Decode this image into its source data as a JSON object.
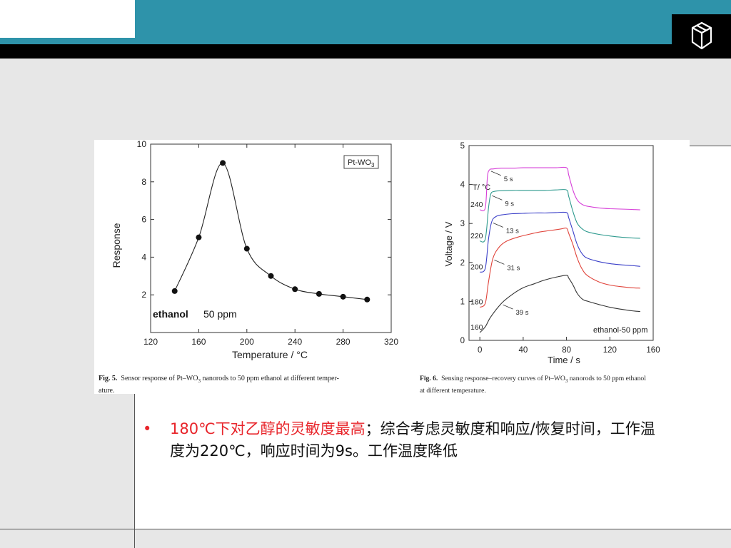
{
  "theme": {
    "teal": "#2e93aa",
    "black": "#000000",
    "red": "#e8252b"
  },
  "header": {
    "logo_icon": "cube-icon"
  },
  "figure5": {
    "caption_label": "Fig. 5.",
    "caption_text": "Sensor response of Pt–WO",
    "caption_sub": "3",
    "caption_rest": " nanorods to 50 ppm ethanol at different temper-",
    "caption_line2": "ature.",
    "legend_main": "Pt-WO",
    "legend_sub": "3",
    "annotation_gas": "ethanol",
    "annotation_conc": "50 ppm"
  },
  "figure6": {
    "caption_label": "Fig. 6.",
    "caption_text": "Sensing response–recovery curves of Pt–WO",
    "caption_sub": "3",
    "caption_rest": " nanorods to 50 ppm ethanol",
    "caption_line2": "at different temperature.",
    "temp_header": "T/ °C",
    "annotation": "ethanol-50 ppm"
  },
  "chart_data": [
    {
      "type": "line",
      "title": "",
      "xlabel": "Temperature / °C",
      "ylabel": "Response",
      "xlim": [
        120,
        320
      ],
      "ylim": [
        0,
        10
      ],
      "xticks": [
        "120",
        "160",
        "200",
        "240",
        "280",
        "320"
      ],
      "yticks": [
        "2",
        "4",
        "6",
        "8",
        "10"
      ],
      "series": [
        {
          "name": "Pt-WO3",
          "x": [
            140,
            160,
            180,
            200,
            220,
            240,
            260,
            280,
            300
          ],
          "values": [
            2.2,
            5.05,
            9.0,
            4.45,
            3.0,
            2.3,
            2.05,
            1.9,
            1.75
          ]
        }
      ]
    },
    {
      "type": "line",
      "title": "",
      "xlabel": "Time / s",
      "ylabel": "Voltage / V",
      "xlim": [
        -10,
        160
      ],
      "ylim": [
        0,
        5
      ],
      "xticks": [
        "0",
        "40",
        "80",
        "120",
        "160"
      ],
      "yticks": [
        "0",
        "1",
        "2",
        "3",
        "4",
        "5"
      ],
      "series": [
        {
          "name": "160",
          "color": "#333333",
          "response_time": "39 s",
          "x": [
            0,
            5,
            10,
            20,
            30,
            40,
            50,
            60,
            70,
            80,
            82,
            86,
            90,
            95,
            100,
            110,
            120,
            130,
            140,
            148
          ],
          "values": [
            0.2,
            0.35,
            0.6,
            0.95,
            1.18,
            1.35,
            1.45,
            1.55,
            1.62,
            1.67,
            1.6,
            1.42,
            1.2,
            1.05,
            1.0,
            0.92,
            0.85,
            0.8,
            0.76,
            0.74
          ]
        },
        {
          "name": "180",
          "color": "#e0433a",
          "response_time": "31 s",
          "x": [
            0,
            5,
            8,
            12,
            18,
            25,
            35,
            45,
            55,
            65,
            75,
            80,
            82,
            86,
            90,
            95,
            100,
            110,
            120,
            130,
            140,
            148
          ],
          "values": [
            0.85,
            0.95,
            1.5,
            2.1,
            2.4,
            2.55,
            2.65,
            2.72,
            2.78,
            2.82,
            2.86,
            2.88,
            2.75,
            2.45,
            2.1,
            1.8,
            1.65,
            1.5,
            1.42,
            1.38,
            1.35,
            1.34
          ]
        },
        {
          "name": "200",
          "color": "#3a3fc8",
          "response_time": "13 s",
          "x": [
            0,
            5,
            8,
            11,
            15,
            20,
            30,
            40,
            50,
            60,
            70,
            80,
            82,
            86,
            90,
            95,
            100,
            110,
            120,
            130,
            140,
            148
          ],
          "values": [
            1.75,
            1.85,
            2.6,
            3.05,
            3.18,
            3.22,
            3.25,
            3.26,
            3.27,
            3.27,
            3.28,
            3.28,
            3.15,
            2.8,
            2.45,
            2.2,
            2.1,
            2.02,
            1.97,
            1.94,
            1.92,
            1.9
          ]
        },
        {
          "name": "220",
          "color": "#2e9a8e",
          "response_time": "9 s",
          "x": [
            0,
            5,
            8,
            10,
            13,
            20,
            30,
            40,
            50,
            60,
            70,
            80,
            82,
            86,
            90,
            95,
            100,
            110,
            120,
            130,
            140,
            148
          ],
          "values": [
            2.55,
            2.6,
            3.4,
            3.75,
            3.82,
            3.84,
            3.85,
            3.85,
            3.85,
            3.85,
            3.86,
            3.86,
            3.7,
            3.3,
            3.0,
            2.85,
            2.78,
            2.72,
            2.68,
            2.65,
            2.63,
            2.62
          ]
        },
        {
          "name": "240",
          "color": "#d63fd8",
          "response_time": "5 s",
          "x": [
            0,
            5,
            7,
            9,
            12,
            20,
            30,
            40,
            50,
            60,
            70,
            80,
            82,
            86,
            90,
            95,
            100,
            110,
            120,
            130,
            140,
            148
          ],
          "values": [
            3.35,
            3.4,
            4.2,
            4.38,
            4.4,
            4.42,
            4.42,
            4.43,
            4.43,
            4.43,
            4.43,
            4.43,
            4.25,
            3.85,
            3.6,
            3.48,
            3.44,
            3.4,
            3.38,
            3.37,
            3.36,
            3.35
          ]
        }
      ]
    }
  ],
  "bullet": {
    "marker": "•",
    "highlight": "180℃下对乙醇的灵敏度最高",
    "rest": "；综合考虑灵敏度和响应/恢复时间，工作温度为220℃，响应时间为9s。工作温度降低"
  }
}
